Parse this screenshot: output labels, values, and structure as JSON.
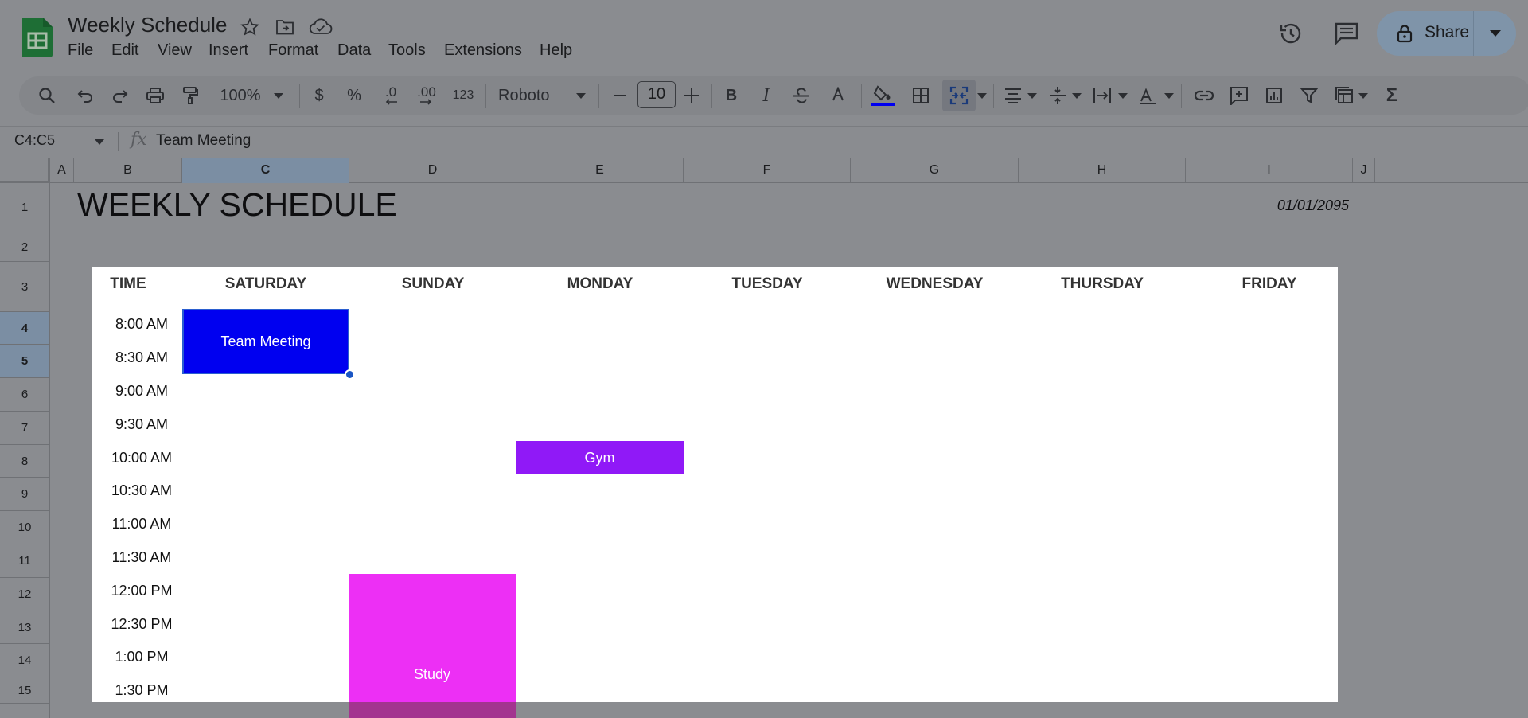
{
  "app": {
    "title": "Weekly Schedule",
    "brand_color": "#1e8e3e",
    "menus": [
      "File",
      "Edit",
      "View",
      "Insert",
      "Format",
      "Data",
      "Tools",
      "Extensions",
      "Help"
    ],
    "share_label": "Share"
  },
  "toolbar": {
    "zoom": "100%",
    "currency": "$",
    "percent": "%",
    "decimal_less": ".0",
    "decimal_more": ".00",
    "number_format": "123",
    "font": "Roboto",
    "font_size": "10"
  },
  "formula_bar": {
    "name_box": "C4:C5",
    "fx": "fx",
    "formula": "Team Meeting"
  },
  "columns": [
    "A",
    "B",
    "C",
    "D",
    "E",
    "F",
    "G",
    "H",
    "I",
    "J"
  ],
  "selected_column": "C",
  "rows": [
    "1",
    "2",
    "3",
    "4",
    "5",
    "6",
    "7",
    "8",
    "9",
    "10",
    "11",
    "12",
    "13",
    "14",
    "15"
  ],
  "selected_rows": [
    "4",
    "5"
  ],
  "sheet": {
    "title": "WEEKLY SCHEDULE",
    "date": "01/01/2095",
    "time_header": "TIME",
    "days": [
      "SATURDAY",
      "SUNDAY",
      "MONDAY",
      "TUESDAY",
      "WEDNESDAY",
      "THURSDAY",
      "FRIDAY"
    ],
    "times": [
      "8:00 AM",
      "8:30 AM",
      "9:00 AM",
      "9:30 AM",
      "10:00 AM",
      "10:30 AM",
      "11:00 AM",
      "11:30 AM",
      "12:00 PM",
      "12:30 PM",
      "1:00 PM",
      "1:30 PM"
    ],
    "events": [
      {
        "label": "Team Meeting",
        "day": "SATURDAY",
        "start": "8:00 AM",
        "end": "8:30 AM",
        "color": "#0000f0"
      },
      {
        "label": "Gym",
        "day": "MONDAY",
        "start": "10:00 AM",
        "end": "10:00 AM",
        "color": "#9019f7"
      },
      {
        "label": "Study",
        "day": "SUNDAY",
        "start": "12:00 PM",
        "end": "1:30 PM",
        "color": "#ed2ff5"
      }
    ]
  }
}
